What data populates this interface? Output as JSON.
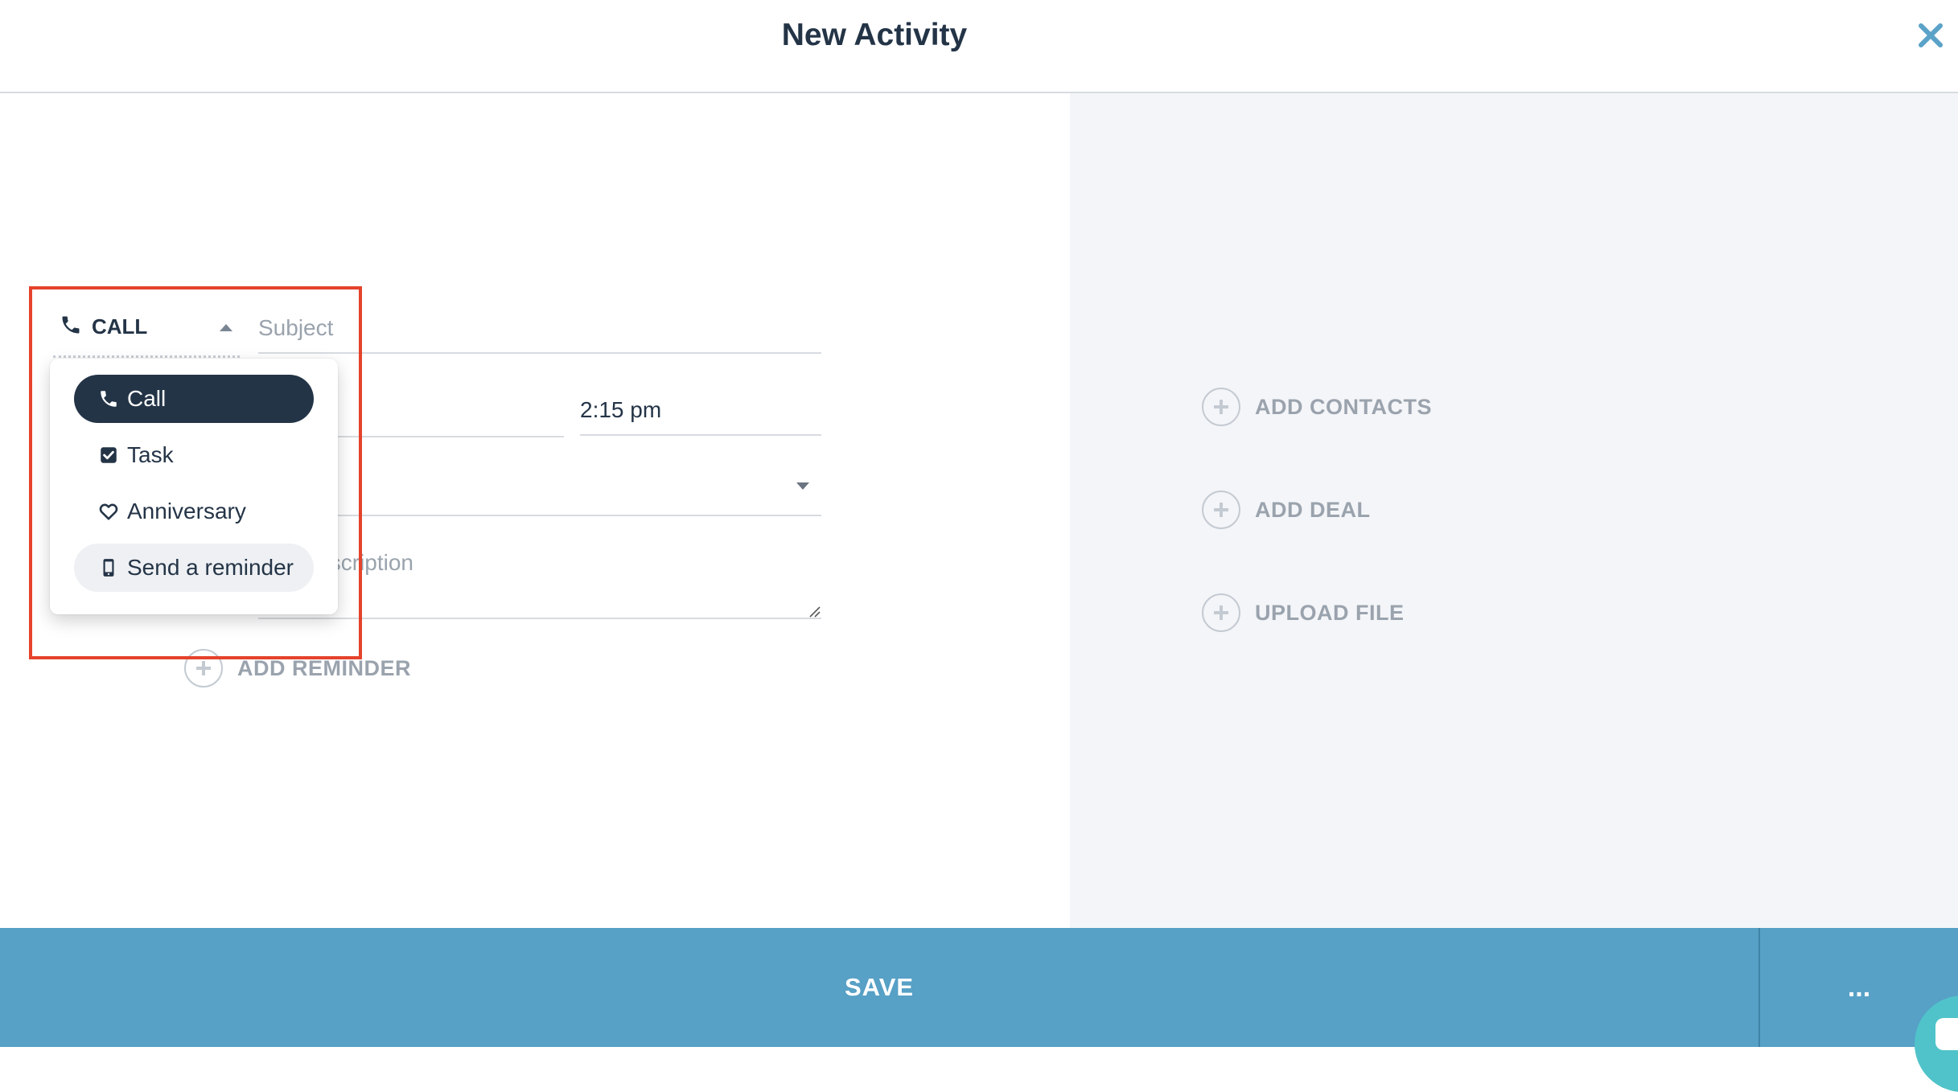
{
  "header": {
    "title": "New Activity",
    "close_icon": "close-icon"
  },
  "form": {
    "type_label": "CALL",
    "subject_placeholder": "Subject",
    "time_value": "2:15 pm",
    "description_placeholder": "Add description",
    "add_reminder_label": "ADD REMINDER"
  },
  "type_menu": {
    "items": [
      {
        "label": "Call",
        "icon": "phone-icon",
        "state": "selected"
      },
      {
        "label": "Task",
        "icon": "checkbox-icon",
        "state": ""
      },
      {
        "label": "Anniversary",
        "icon": "heart-icon",
        "state": ""
      },
      {
        "label": "Send a reminder",
        "icon": "mobile-phone-icon",
        "state": "hover"
      }
    ]
  },
  "side_actions": {
    "add_contacts": "ADD CONTACTS",
    "add_deal": "ADD DEAL",
    "upload_file": "UPLOAD FILE"
  },
  "footer": {
    "save_label": "SAVE",
    "more_label": "..."
  },
  "colors": {
    "accent": "#57a0c6",
    "dark": "#243447",
    "muted": "#9aa3ad",
    "highlight": "#e5432b",
    "side_panel": "#f4f5f8"
  }
}
